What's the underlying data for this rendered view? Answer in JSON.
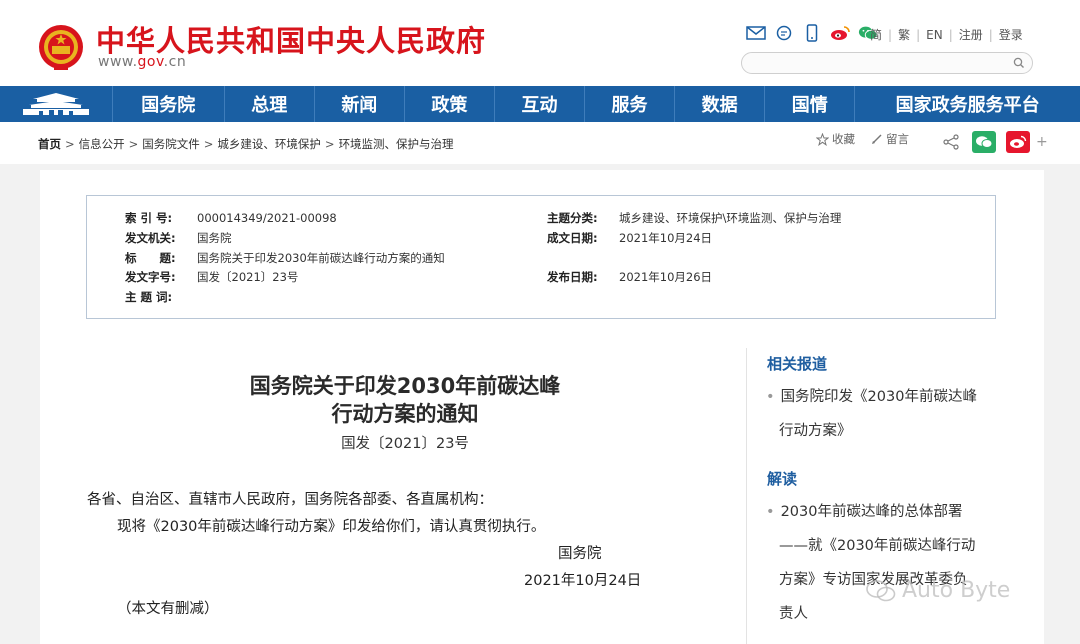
{
  "header": {
    "site_title": "中华人民共和国中央人民政府",
    "site_url_prefix": "www.",
    "site_url_gov": "gov",
    "site_url_suffix": ".cn",
    "icons": [
      "mail-icon",
      "chat-icon",
      "mobile-icon",
      "weibo-icon",
      "wechat-icon"
    ],
    "lang_links": [
      "简",
      "繁",
      "EN",
      "注册",
      "登录"
    ],
    "search_placeholder": ""
  },
  "nav": {
    "items": [
      "国务院",
      "总理",
      "新闻",
      "政策",
      "互动",
      "服务",
      "数据",
      "国情",
      "国家政务服务平台"
    ]
  },
  "breadcrumb": {
    "home": "首页",
    "items": [
      "信息公开",
      "国务院文件",
      "城乡建设、环境保护",
      "环境监测、保护与治理"
    ],
    "separator": ">"
  },
  "tools": {
    "favorite": "收藏",
    "comment": "留言",
    "plus": "+"
  },
  "meta": {
    "index_no_label": "索 引 号:",
    "index_no": "000014349/2021-00098",
    "issuer_label": "发文机关:",
    "issuer": "国务院",
    "title_label": "标　　题:",
    "title": "国务院关于印发2030年前碳达峰行动方案的通知",
    "doc_no_label": "发文字号:",
    "doc_no": "国发〔2021〕23号",
    "keywords_label": "主 题 词:",
    "keywords": "",
    "category_label": "主题分类:",
    "category": "城乡建设、环境保护\\环境监测、保护与治理",
    "written_date_label": "成文日期:",
    "written_date": "2021年10月24日",
    "publish_date_label": "发布日期:",
    "publish_date": "2021年10月26日"
  },
  "article": {
    "title_line1": "国务院关于印发2030年前碳达峰",
    "title_line2": "行动方案的通知",
    "doc_no": "国发〔2021〕23号",
    "salutation": "各省、自治区、直辖市人民政府，国务院各部委、各直属机构：",
    "body": "现将《2030年前碳达峰行动方案》印发给你们，请认真贯彻执行。",
    "signature": "国务院",
    "date": "2021年10月24日",
    "note": "（本文有删减）"
  },
  "sidebar": {
    "related_heading": "相关报道",
    "related_items": [
      {
        "line1": "国务院印发《2030年前碳达峰",
        "line2": "行动方案》"
      }
    ],
    "interpret_heading": "解读",
    "interpret_items": [
      {
        "line1": "2030年前碳达峰的总体部署",
        "line2": "——就《2030年前碳达峰行动",
        "line3": "方案》专访国家发展改革委负",
        "line4": "责人"
      }
    ]
  },
  "watermark": {
    "text": "Auto Byte"
  },
  "colors": {
    "brand_red": "#d7141c",
    "nav_blue": "#1a5fa3",
    "link_blue": "#1f5ea0"
  }
}
